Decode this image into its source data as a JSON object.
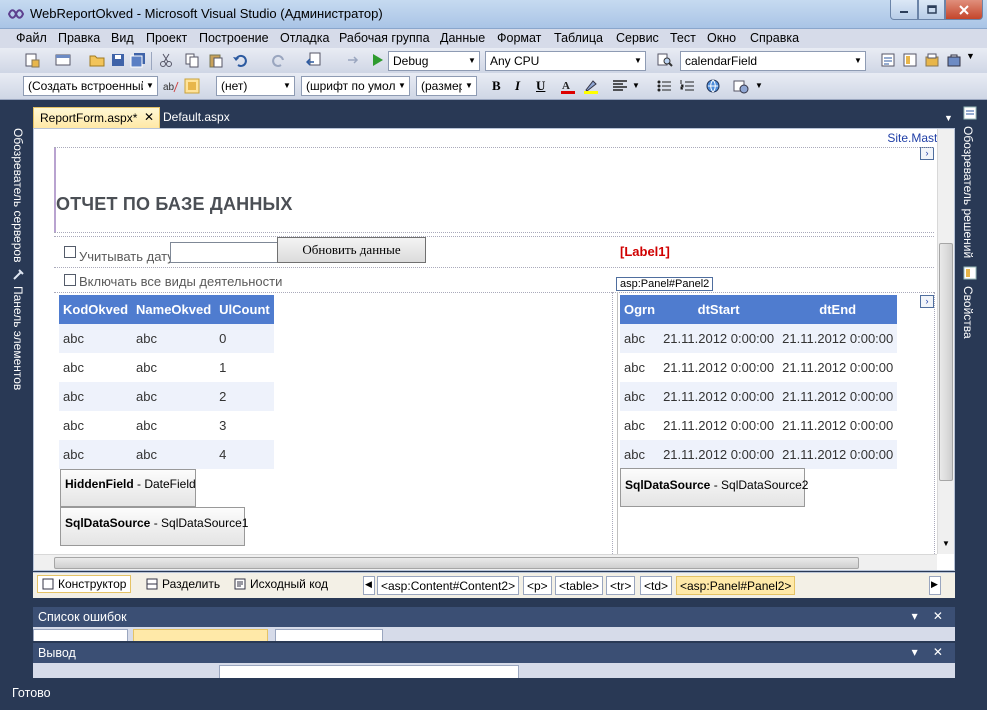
{
  "window": {
    "title": "WebReportOkved - Microsoft Visual Studio (Администратор)"
  },
  "menu": [
    "Файл",
    "Правка",
    "Вид",
    "Проект",
    "Построение",
    "Отладка",
    "Рабочая группа",
    "Данные",
    "Формат",
    "Таблица",
    "Сервис",
    "Тест",
    "Окно",
    "Справка"
  ],
  "toolbar1": {
    "config": "Debug",
    "platform": "Any CPU",
    "find": "calendarField"
  },
  "toolbar2": {
    "block_format": "(Создать встроенный",
    "target": "(нет)",
    "font": "(шрифт по умол",
    "size": "(размер",
    "bold": "B",
    "italic": "I",
    "underline": "U"
  },
  "side_panes": {
    "left_top": "Обозреватель серверов",
    "left_bottom": "Панель элементов",
    "right_top": "Обозреватель решений",
    "right_bottom": "Свойства"
  },
  "doc_tabs": {
    "active": "ReportForm.aspx*",
    "other": "Default.aspx"
  },
  "designer": {
    "master": "Site.Master",
    "heading": "ОТЧЕТ ПО БАЗЕ ДАННЫХ",
    "consider_date": "Учитывать дату",
    "refresh_button": "Обновить данные",
    "include_all": "Включать все виды деятельности",
    "label1": "[Label1]",
    "panel_tag": "asp:Panel#Panel2",
    "grid1": {
      "headers": [
        "KodOkved",
        "NameOkved",
        "UlCount"
      ],
      "rows": [
        [
          "abc",
          "abc",
          "0"
        ],
        [
          "abc",
          "abc",
          "1"
        ],
        [
          "abc",
          "abc",
          "2"
        ],
        [
          "abc",
          "abc",
          "3"
        ],
        [
          "abc",
          "abc",
          "4"
        ]
      ]
    },
    "grid2": {
      "headers": [
        "Ogrn",
        "dtStart",
        "dtEnd"
      ],
      "rows": [
        [
          "abc",
          "21.11.2012 0:00:00",
          "21.11.2012 0:00:00"
        ],
        [
          "abc",
          "21.11.2012 0:00:00",
          "21.11.2012 0:00:00"
        ],
        [
          "abc",
          "21.11.2012 0:00:00",
          "21.11.2012 0:00:00"
        ],
        [
          "abc",
          "21.11.2012 0:00:00",
          "21.11.2012 0:00:00"
        ],
        [
          "abc",
          "21.11.2012 0:00:00",
          "21.11.2012 0:00:00"
        ]
      ]
    },
    "hidden_field": {
      "type": "HiddenField",
      "name": " - DateField"
    },
    "sql_source1": {
      "type": "SqlDataSource",
      "name": " - SqlDataSource1"
    },
    "sql_source2": {
      "type": "SqlDataSource",
      "name": " - SqlDataSource2"
    }
  },
  "viewbar": {
    "design": "Конструктор",
    "split": "Разделить",
    "source": "Исходный код",
    "crumbs": [
      "<asp:Content#Content2>",
      "<p>",
      "<table>",
      "<tr>",
      "<td>",
      "<asp:Panel#Panel2>"
    ]
  },
  "errors_title": "Список ошибок",
  "output_title": "Вывод",
  "status": "Готово",
  "colors": {
    "chrome": "#293955",
    "grid_header": "#4f7ccf",
    "label_red": "#d00000",
    "active_tab": "#ffe8a6"
  }
}
